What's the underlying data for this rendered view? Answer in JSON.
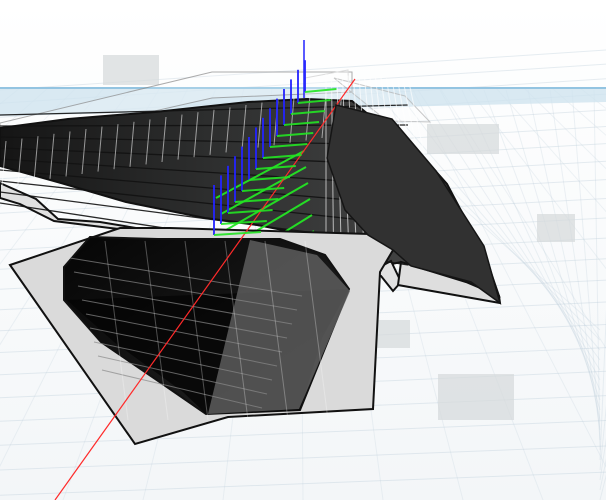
{
  "scene": {
    "background_color": "#f7f9fa",
    "grid_color": "#b9cbd8",
    "horizon_color": "#b8d5e8",
    "water_color": "#cde3ee",
    "deck_color": "#2f3030",
    "deck_edge_color": "#111111",
    "section_fill_color": "#d9d9d9",
    "section_outline_color": "#111111",
    "axis_colors": {
      "x_axis": "#ff2a2a",
      "y_axis": "#23e523",
      "z_axis": "#2323ff"
    },
    "ghost_panels": [
      {
        "name": "ghost-panel-top-left"
      },
      {
        "name": "ghost-panel-right-upper"
      },
      {
        "name": "ghost-panel-right-middle"
      },
      {
        "name": "ghost-panel-center-right"
      },
      {
        "name": "ghost-panel-bottom-right"
      }
    ]
  }
}
